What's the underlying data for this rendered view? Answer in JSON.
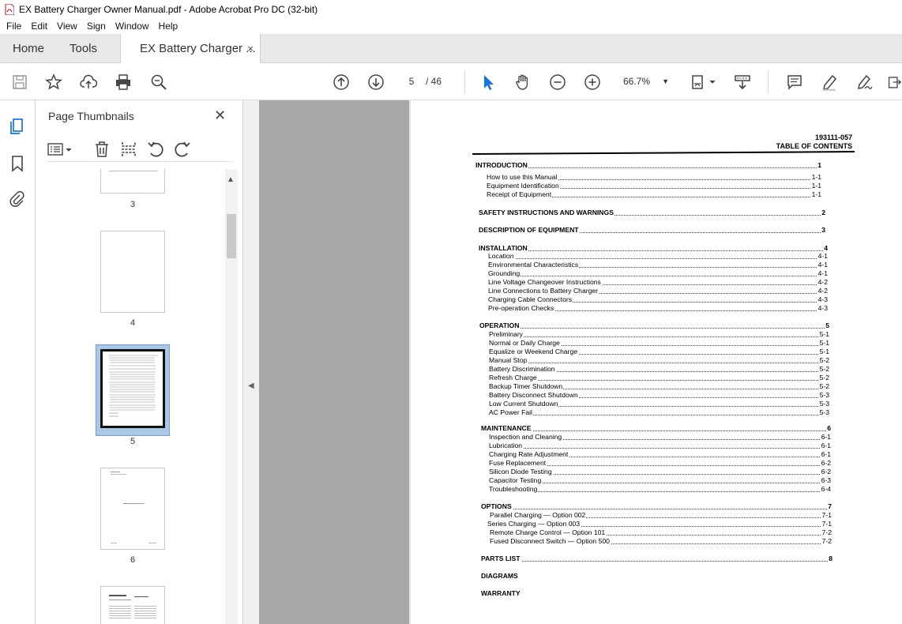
{
  "window": {
    "title": "EX Battery Charger Owner Manual.pdf - Adobe Acrobat Pro DC (32-bit)"
  },
  "menu": [
    "File",
    "Edit",
    "View",
    "Sign",
    "Window",
    "Help"
  ],
  "tabs": {
    "home": "Home",
    "tools": "Tools",
    "document": "EX Battery Charger ...",
    "close_glyph": "×"
  },
  "toolbar": {
    "current_page": "5",
    "page_separator": "/  46",
    "zoom": "66.7%",
    "icons": [
      "save-icon",
      "bookmark-star-icon",
      "upload-cloud-icon",
      "print-icon",
      "zoom-search-icon",
      "prev-page-icon",
      "next-page-icon",
      "select-cursor-icon",
      "hand-tool-icon",
      "zoom-out-icon",
      "zoom-in-icon",
      "page-fit-icon",
      "scroll-mode-icon",
      "comment-icon",
      "highlight-pen-icon",
      "sign-pen-icon",
      "export-icon"
    ]
  },
  "rail": {
    "icons": [
      "page-thumbnails-icon",
      "bookmarks-icon",
      "attachments-icon"
    ]
  },
  "thumbnail_panel": {
    "title": "Page Thumbnails",
    "close_glyph": "✕",
    "pages": [
      {
        "label": "3"
      },
      {
        "label": "4"
      },
      {
        "label": "5",
        "selected": true
      },
      {
        "label": "6"
      }
    ]
  },
  "document": {
    "doc_number": "193111-057",
    "heading": "TABLE OF CONTENTS",
    "entries": [
      {
        "text": "INTRODUCTION",
        "page": "1",
        "section": true
      },
      {
        "text": "How to use this Manual",
        "page": "1-1"
      },
      {
        "text": "Equipment Identification",
        "page": "1-1"
      },
      {
        "text": "Receipt of Equipment",
        "page": "1-1"
      },
      {
        "text": "SAFETY INSTRUCTIONS AND WARNINGS",
        "page": "2",
        "section": true
      },
      {
        "text": "DESCRIPTION OF EQUIPMENT",
        "page": "3",
        "section": true
      },
      {
        "text": "INSTALLATION",
        "page": "4",
        "section": true
      },
      {
        "text": "Location",
        "page": "4-1"
      },
      {
        "text": "Environmental Characteristics",
        "page": "4-1"
      },
      {
        "text": "Grounding",
        "page": "4-1"
      },
      {
        "text": "Line Voltage Changeover Instructions",
        "page": "4-2"
      },
      {
        "text": "Line Connections to Battery Charger",
        "page": "4-2"
      },
      {
        "text": "Charging Cable Connectors",
        "page": "4-3"
      },
      {
        "text": "Pre-operation Checks",
        "page": "4-3"
      },
      {
        "text": "OPERATION",
        "page": "5",
        "section": true
      },
      {
        "text": "Preliminary",
        "page": "5-1"
      },
      {
        "text": "Normal or Daily Charge",
        "page": "5-1"
      },
      {
        "text": "Equalize or Weekend Charge",
        "page": "5-1"
      },
      {
        "text": "Manual Stop",
        "page": "5-2"
      },
      {
        "text": "Battery Discrimination",
        "page": "5-2"
      },
      {
        "text": "Refresh Charge",
        "page": "5-2"
      },
      {
        "text": "Backup Timer Shutdown",
        "page": "5-2"
      },
      {
        "text": "Battery Disconnect Shutdown",
        "page": "5-3"
      },
      {
        "text": "Low Current Shutdown",
        "page": "5-3"
      },
      {
        "text": "AC Power Fail",
        "page": "5-3"
      },
      {
        "text": "MAINTENANCE",
        "page": "6",
        "section": true
      },
      {
        "text": "Inspection and Cleaning",
        "page": "6-1"
      },
      {
        "text": "Lubrication",
        "page": "6-1"
      },
      {
        "text": "Charging Rate Adjustment",
        "page": "6-1"
      },
      {
        "text": "Fuse Replacement",
        "page": "6-2"
      },
      {
        "text": "Silicon Diode Testing",
        "page": "6-2"
      },
      {
        "text": "Capacitor Testing",
        "page": "6-3"
      },
      {
        "text": "Troubleshooting",
        "page": "6-4"
      },
      {
        "text": "OPTIONS",
        "page": "7",
        "section": true
      },
      {
        "text": "Parallel Charging — Option 002",
        "page": "7-1"
      },
      {
        "text": "Series Charging — Option 003",
        "page": "7-1"
      },
      {
        "text": "Remote Charge Control — Option 101",
        "page": "7-2"
      },
      {
        "text": "Fused Disconnect  Switch — Option 500",
        "page": "7-2"
      },
      {
        "text": "PARTS LIST",
        "page": "8",
        "section": true
      },
      {
        "text": "DIAGRAMS",
        "page": "",
        "section": true
      },
      {
        "text": "WARRANTY",
        "page": "",
        "section": true
      }
    ]
  }
}
